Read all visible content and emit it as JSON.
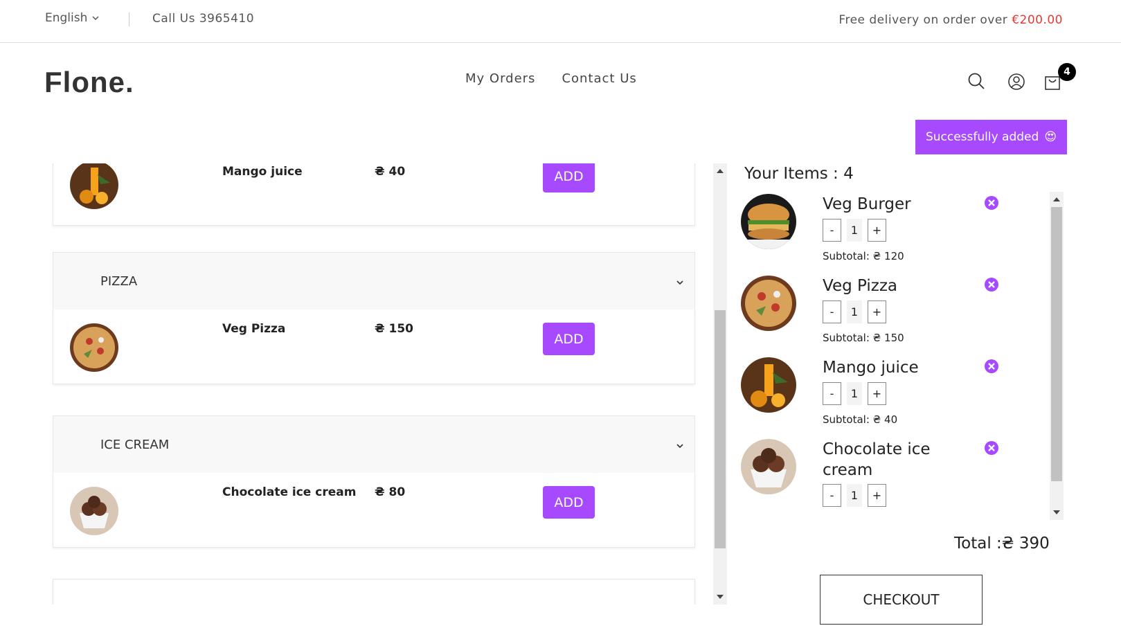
{
  "topbar": {
    "language": "English",
    "call": "Call Us 3965410",
    "delivery_text": "Free delivery on order over ",
    "delivery_amount": "€200.00"
  },
  "header": {
    "logo": "Flone.",
    "nav": [
      "My Orders",
      "Contact Us"
    ],
    "cart_count": "4"
  },
  "toast": {
    "text": "Successfully added",
    "emoji": "😍"
  },
  "menu": {
    "items": [
      {
        "name": "Mango juice",
        "price": "₴ 40",
        "button": "ADD",
        "image": "mango-juice"
      },
      {
        "name": "Veg Pizza",
        "price": "₴ 150",
        "button": "ADD",
        "image": "veg-pizza"
      },
      {
        "name": "Chocolate ice cream",
        "price": "₴ 80",
        "button": "ADD",
        "image": "chocolate-ice-cream"
      }
    ],
    "categories": [
      "PIZZA",
      "ICE CREAM"
    ]
  },
  "cart": {
    "title": "Your Items : 4",
    "items": [
      {
        "name": "Veg Burger",
        "qty": "1",
        "subtotal": "Subtotal: ₴ 120"
      },
      {
        "name": "Veg Pizza",
        "qty": "1",
        "subtotal": "Subtotal: ₴ 150"
      },
      {
        "name": "Mango juice",
        "qty": "1",
        "subtotal": "Subtotal: ₴ 40"
      },
      {
        "name": "Chocolate ice cream",
        "qty": "1",
        "subtotal": ""
      }
    ],
    "minus": "-",
    "plus": "+",
    "total": "Total :₴ 390",
    "checkout": "CHECKOUT"
  },
  "colors": {
    "accent": "#a749ff",
    "price_red": "#e53935",
    "remove_icon": "#a749ff"
  }
}
